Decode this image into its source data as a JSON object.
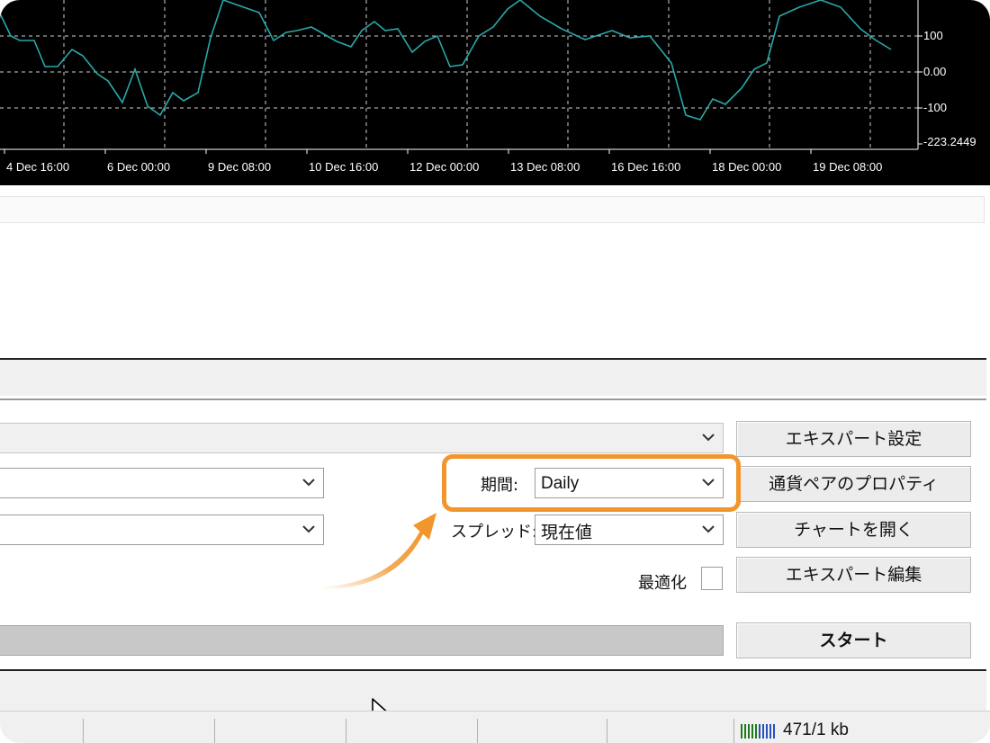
{
  "chart": {
    "price_labels": [
      "100",
      "0.00",
      "-100",
      "-223.2449"
    ],
    "date_labels": [
      "4 Dec 16:00",
      "6 Dec 00:00",
      "9 Dec 08:00",
      "10 Dec 16:00",
      "12 Dec 00:00",
      "13 Dec 08:00",
      "16 Dec 16:00",
      "18 Dec 00:00",
      "19 Dec 08:00"
    ],
    "colors": {
      "background": "#000000",
      "line": "#2aa8a8",
      "grid": "#cfcfcf",
      "text": "#ffffff"
    }
  },
  "settings": {
    "expert_settings_button": "エキスパート設定",
    "period_label": "期間:",
    "period_value": "Daily",
    "symbol_properties_button": "通貨ペアのプロパティ",
    "spread_label": "スプレッド:",
    "spread_value": "現在値",
    "open_chart_button": "チャートを開く",
    "optimization_label": "最適化",
    "edit_expert_button": "エキスパート編集",
    "start_button": "スタート"
  },
  "highlight_color": "#f0962c",
  "statusbar": {
    "traffic": "471/1 kb"
  }
}
